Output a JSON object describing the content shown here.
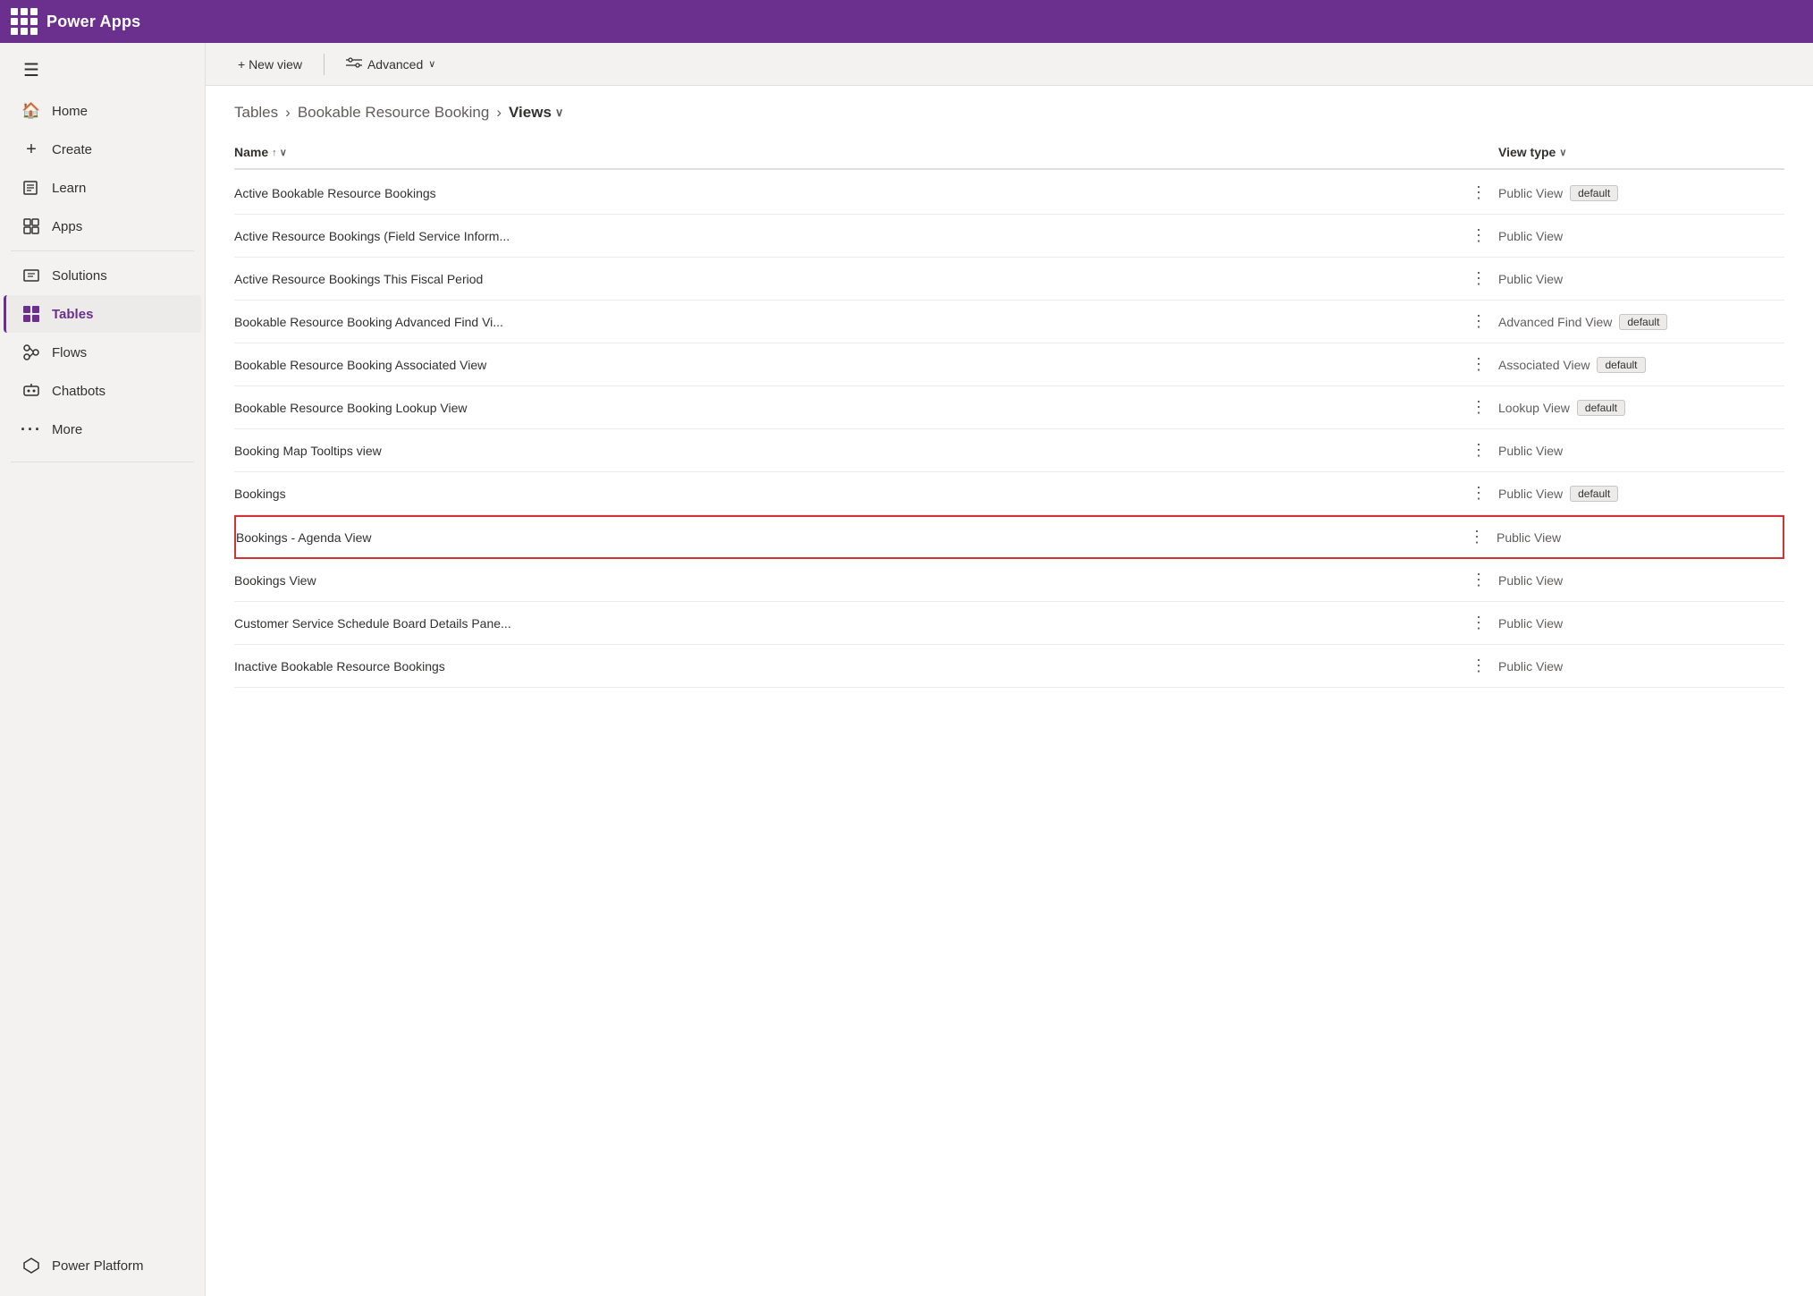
{
  "topBar": {
    "title": "Power Apps",
    "gridIcon": "waffle-icon"
  },
  "sidebar": {
    "menuIcon": "hamburger-icon",
    "items": [
      {
        "id": "home",
        "label": "Home",
        "icon": "🏠"
      },
      {
        "id": "create",
        "label": "Create",
        "icon": "＋"
      },
      {
        "id": "learn",
        "label": "Learn",
        "icon": "📖"
      },
      {
        "id": "apps",
        "label": "Apps",
        "icon": "🎁"
      },
      {
        "id": "solutions",
        "label": "Solutions",
        "icon": "📋"
      },
      {
        "id": "tables",
        "label": "Tables",
        "icon": "⊞",
        "active": true
      },
      {
        "id": "flows",
        "label": "Flows",
        "icon": "⚙"
      },
      {
        "id": "chatbots",
        "label": "Chatbots",
        "icon": "🤖"
      },
      {
        "id": "more",
        "label": "More",
        "icon": "…"
      }
    ],
    "bottomItems": [
      {
        "id": "power-platform",
        "label": "Power Platform",
        "icon": "⬡"
      }
    ]
  },
  "toolbar": {
    "newViewLabel": "+ New view",
    "advancedLabel": "Advanced",
    "advancedIcon": "filter-icon",
    "chevronIcon": "chevron-down-icon"
  },
  "breadcrumb": {
    "tables": "Tables",
    "resource": "Bookable Resource Booking",
    "current": "Views",
    "chevron": "∨"
  },
  "table": {
    "columns": [
      {
        "id": "name",
        "label": "Name",
        "sortIcon": "↑ ∨"
      },
      {
        "id": "viewtype",
        "label": "View type",
        "sortIcon": "∨"
      }
    ],
    "rows": [
      {
        "name": "Active Bookable Resource Bookings",
        "viewType": "Public View",
        "badge": "default",
        "highlighted": false
      },
      {
        "name": "Active Resource Bookings (Field Service Inform...",
        "viewType": "Public View",
        "badge": null,
        "highlighted": false
      },
      {
        "name": "Active Resource Bookings This Fiscal Period",
        "viewType": "Public View",
        "badge": null,
        "highlighted": false
      },
      {
        "name": "Bookable Resource Booking Advanced Find Vi...",
        "viewType": "Advanced Find View",
        "badge": "default",
        "highlighted": false
      },
      {
        "name": "Bookable Resource Booking Associated View",
        "viewType": "Associated View",
        "badge": "default",
        "highlighted": false
      },
      {
        "name": "Bookable Resource Booking Lookup View",
        "viewType": "Lookup View",
        "badge": "default",
        "highlighted": false
      },
      {
        "name": "Booking Map Tooltips view",
        "viewType": "Public View",
        "badge": null,
        "highlighted": false
      },
      {
        "name": "Bookings",
        "viewType": "Public View",
        "badge": "default",
        "highlighted": false
      },
      {
        "name": "Bookings - Agenda View",
        "viewType": "Public View",
        "badge": null,
        "highlighted": true
      },
      {
        "name": "Bookings View",
        "viewType": "Public View",
        "badge": null,
        "highlighted": false
      },
      {
        "name": "Customer Service Schedule Board Details Pane...",
        "viewType": "Public View",
        "badge": null,
        "highlighted": false
      },
      {
        "name": "Inactive Bookable Resource Bookings",
        "viewType": "Public View",
        "badge": null,
        "highlighted": false
      }
    ]
  },
  "colors": {
    "topBar": "#6b2f8e",
    "activeNav": "#6b2f8e",
    "highlightBorder": "#d13438"
  }
}
